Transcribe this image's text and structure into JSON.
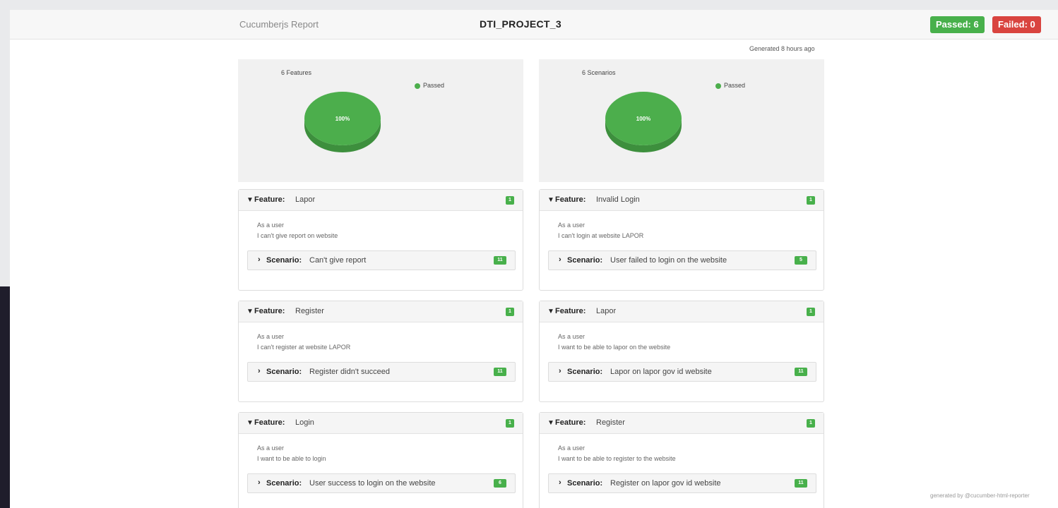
{
  "header": {
    "brand": "Cucumberjs Report",
    "project": "DTI_PROJECT_3",
    "passed_label": "Passed: 6",
    "failed_label": "Failed: 0",
    "generated": "Generated 8 hours ago"
  },
  "charts": [
    {
      "title": "6 Features",
      "legend": "Passed",
      "center_label": "100%",
      "passed_percent": 100
    },
    {
      "title": "6 Scenarios",
      "legend": "Passed",
      "center_label": "100%",
      "passed_percent": 100
    }
  ],
  "features": [
    {
      "label": "Feature:",
      "name": "Lapor",
      "count": "1",
      "desc1": "As a user",
      "desc2": "I can't give report on website",
      "scenario_label": "Scenario:",
      "scenario": "Can't give report",
      "scenario_count": "11"
    },
    {
      "label": "Feature:",
      "name": "Invalid Login",
      "count": "1",
      "desc1": "As a user",
      "desc2": "I can't login at website LAPOR",
      "scenario_label": "Scenario:",
      "scenario": "User failed to login on the website",
      "scenario_count": "5"
    },
    {
      "label": "Feature:",
      "name": "Register",
      "count": "1",
      "desc1": "As a user",
      "desc2": "I can't register at website LAPOR",
      "scenario_label": "Scenario:",
      "scenario": "Register didn't succeed",
      "scenario_count": "11"
    },
    {
      "label": "Feature:",
      "name": "Lapor",
      "count": "1",
      "desc1": "As a user",
      "desc2": "I want to be able to lapor on the website",
      "scenario_label": "Scenario:",
      "scenario": "Lapor on lapor gov id website",
      "scenario_count": "11"
    },
    {
      "label": "Feature:",
      "name": "Login",
      "count": "1",
      "desc1": "As a user",
      "desc2": "I want to be able to login",
      "scenario_label": "Scenario:",
      "scenario": "User success to login on the website",
      "scenario_count": "6"
    },
    {
      "label": "Feature:",
      "name": "Register",
      "count": "1",
      "desc1": "As a user",
      "desc2": "I want to be able to register to the website",
      "scenario_label": "Scenario:",
      "scenario": "Register on lapor gov id website",
      "scenario_count": "11"
    }
  ],
  "footer": {
    "note": "generated by @cucumber-html-reporter"
  },
  "colors": {
    "passed": "#48b04b",
    "failed": "#d9443f",
    "pie": "#4cae4c",
    "pie_side": "#3d8f3d"
  }
}
